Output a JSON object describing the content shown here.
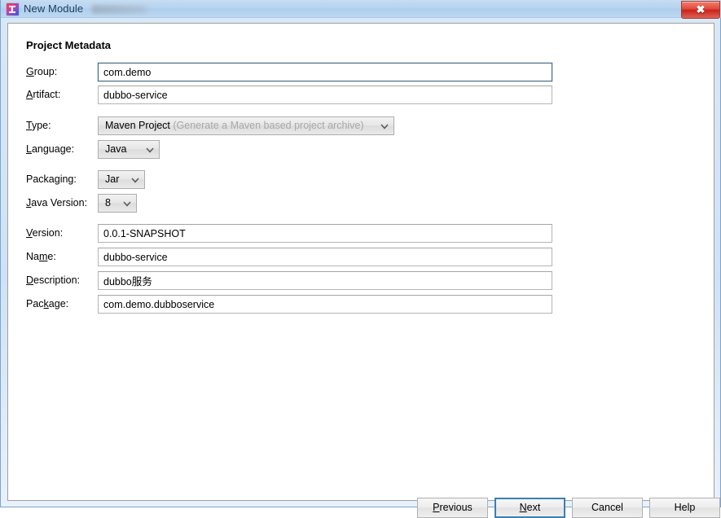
{
  "window": {
    "title": "New Module",
    "icon": "intellij-idea-icon",
    "close_label": "✖",
    "redacted_present": true
  },
  "form": {
    "section_title": "Project Metadata",
    "fields": [
      {
        "label": "Group:",
        "mnemonic": "G",
        "value": "com.demo",
        "type": "text",
        "focused": true
      },
      {
        "label": "Artifact:",
        "mnemonic": "A",
        "value": "dubbo-service",
        "type": "text",
        "focused": false
      },
      {
        "label": "Type:",
        "mnemonic": "T",
        "value": "Maven Project",
        "hint": "(Generate a Maven based project archive)",
        "type": "combo"
      },
      {
        "label": "Language:",
        "mnemonic": "L",
        "value": "Java",
        "type": "combo"
      },
      {
        "label": "Packaging:",
        "mnemonic": "g",
        "value": "Jar",
        "type": "combo"
      },
      {
        "label": "Java Version:",
        "mnemonic": "J",
        "value": "8",
        "type": "combo"
      },
      {
        "label": "Version:",
        "mnemonic": "V",
        "value": "0.0.1-SNAPSHOT",
        "type": "text",
        "focused": false
      },
      {
        "label": "Name:",
        "mnemonic": "m",
        "value": "dubbo-service",
        "type": "text",
        "focused": false
      },
      {
        "label": "Description:",
        "mnemonic": "D",
        "value": "dubbo服务",
        "type": "text",
        "focused": false
      },
      {
        "label": "Package:",
        "mnemonic": "k",
        "value": "com.demo.dubboservice",
        "type": "text",
        "focused": false
      }
    ]
  },
  "buttons": {
    "previous": "Previous",
    "next": "Next",
    "cancel": "Cancel",
    "help": "Help"
  },
  "colors": {
    "titlebar": "#b7d3ee",
    "close_button": "#c9231a",
    "focus_blue": "#3c7fb1",
    "field_border": "#b4b4b4",
    "hint_gray": "#a8a8a8"
  }
}
